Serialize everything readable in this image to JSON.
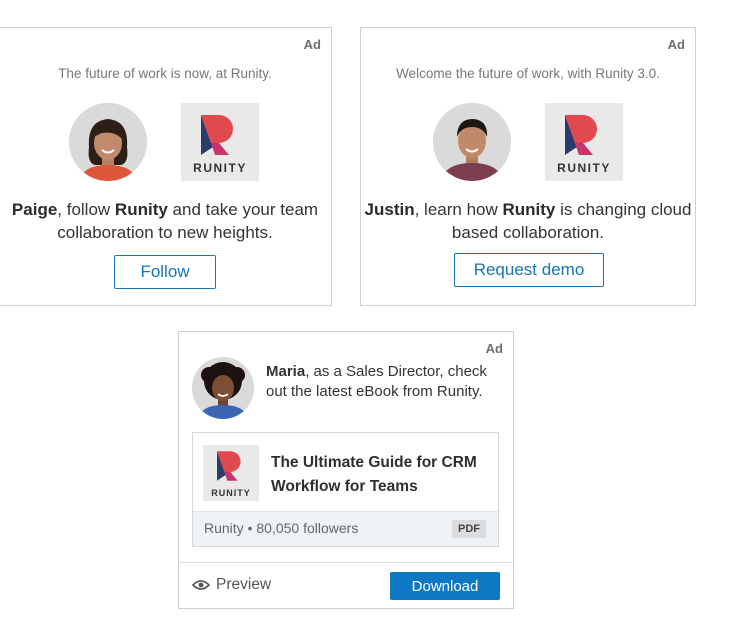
{
  "ad_label": "Ad",
  "brand": {
    "wordmark": "RUNITY",
    "colors": {
      "blue": "#2a3b6e",
      "red": "#e04a4f",
      "pink": "#c7346b"
    }
  },
  "card1": {
    "tagline": "The future of work is now, at Runity.",
    "message": {
      "name": "Paige",
      "pre": ", follow ",
      "brand": "Runity",
      "post": " and take your team collaboration to new heights."
    },
    "button_label": "Follow"
  },
  "card2": {
    "tagline": "Welcome the future of work, with Runity 3.0.",
    "message": {
      "name": "Justin",
      "pre": ", learn how ",
      "brand": "Runity",
      "post": " is changing cloud based collaboration."
    },
    "button_label": "Request demo"
  },
  "card3": {
    "message": {
      "name": "Maria",
      "rest": ", as a Sales Director, check out the latest eBook from Runity."
    },
    "document": {
      "title": "The Ultimate Guide for CRM Workflow for Teams",
      "company": "Runity",
      "separator": "•",
      "followers": "80,050 followers",
      "type_badge": "PDF"
    },
    "preview_label": "Preview",
    "download_label": "Download",
    "accent_color": "#0e78c2"
  }
}
